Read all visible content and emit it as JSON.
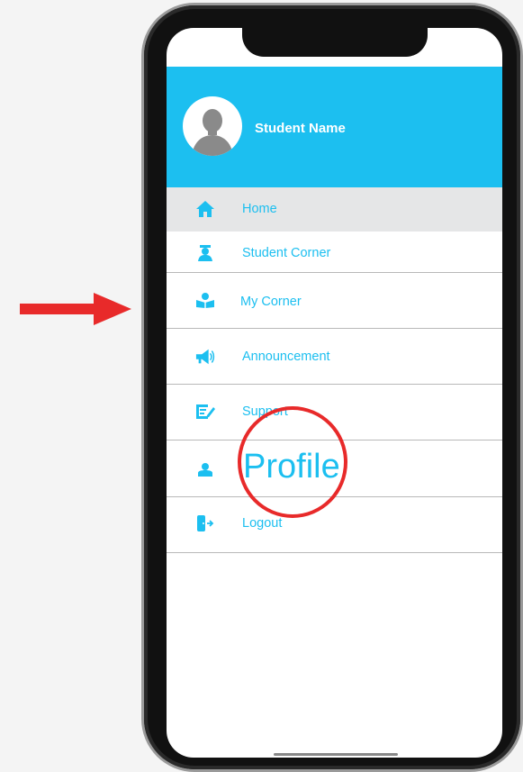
{
  "colors": {
    "accent": "#1cbff0",
    "annotation": "#e82a2a",
    "active_row": "#e5e6e7",
    "divider": "#b8b8b8"
  },
  "header": {
    "student_name": "Student Name"
  },
  "menu": {
    "items": [
      {
        "label": "Home",
        "icon": "home-icon",
        "active": true
      },
      {
        "label": "Student Corner",
        "icon": "graduate-icon"
      },
      {
        "label": "My Corner",
        "icon": "reading-icon"
      },
      {
        "label": "Announcement",
        "icon": "megaphone-icon"
      },
      {
        "label": "Support",
        "icon": "edit-icon"
      },
      {
        "label": "",
        "icon": "user-icon"
      },
      {
        "label": "Logout",
        "icon": "logout-icon"
      }
    ]
  },
  "annotation": {
    "profile_label": "Profile"
  }
}
